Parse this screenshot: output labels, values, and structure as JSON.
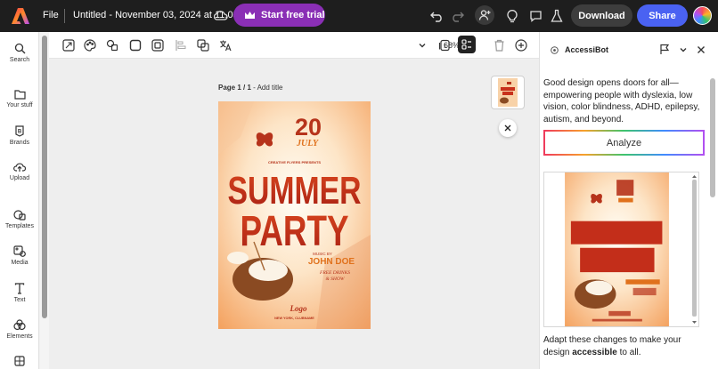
{
  "topbar": {
    "file_label": "File",
    "doc_title": "Untitled - November 03, 2024 at 11.03.32",
    "trial_label": "Start free trial",
    "download_label": "Download",
    "share_label": "Share"
  },
  "sidebar": {
    "items": [
      {
        "label": "Search",
        "icon": "search-icon"
      },
      {
        "label": "Your stuff",
        "icon": "folder-icon"
      },
      {
        "label": "Brands",
        "icon": "brand-icon"
      },
      {
        "label": "Upload",
        "icon": "upload-icon"
      },
      {
        "label": "Templates",
        "icon": "templates-icon"
      },
      {
        "label": "Media",
        "icon": "media-icon"
      },
      {
        "label": "Text",
        "icon": "text-icon"
      },
      {
        "label": "Elements",
        "icon": "elements-icon"
      }
    ]
  },
  "toolbar": {
    "zoom": "68%"
  },
  "canvas": {
    "page_label": "Page 1 / 1",
    "add_title": " - Add title"
  },
  "poster": {
    "date_number": "20",
    "date_month": "JULY",
    "presents": "CREATIVE FLYERS PRESENTS",
    "title_line1": "SUMMER",
    "title_line2": "PARTY",
    "music_by": "MUSIC BY",
    "artist": "JOHN DOE",
    "drinks_line1": "FREE DRINKS",
    "drinks_line2": "& SHOW",
    "logo_text": "Logo",
    "location": "NEW YORK, CLUBNAME"
  },
  "panel": {
    "title": "AccessiBot",
    "intro": "Good design opens doors for all—empowering people with dyslexia, low vision, color blindness, ADHD, epilepsy, autism, and beyond.",
    "analyze_label": "Analyze",
    "bottom_pre": "Adapt these changes to make your design ",
    "bottom_bold": "accessible",
    "bottom_post": " to all."
  },
  "colors": {
    "trial_purple": "#8a2fb5",
    "share_blue": "#4a62f2",
    "poster_red": "#c8311c",
    "poster_orange": "#f07a1c"
  }
}
